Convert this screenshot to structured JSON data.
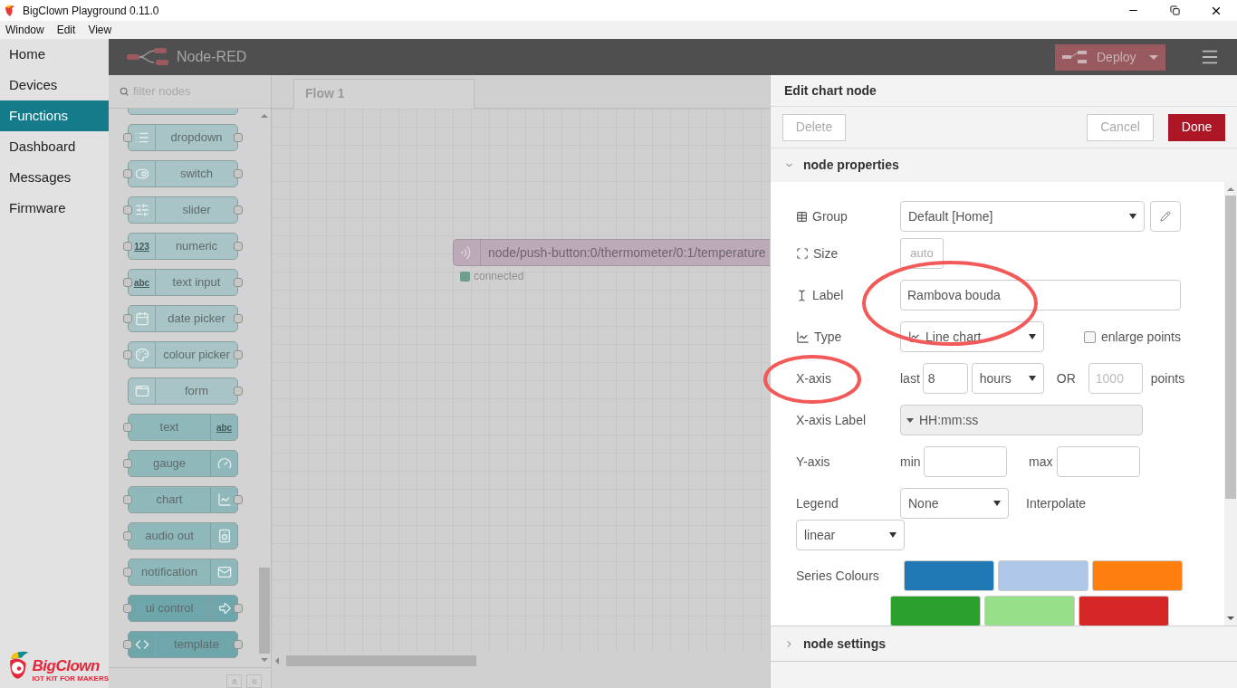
{
  "window": {
    "title": "BigClown Playground 0.11.0"
  },
  "menu": [
    "Window",
    "Edit",
    "View"
  ],
  "nav": [
    {
      "label": "Home",
      "selected": false
    },
    {
      "label": "Devices",
      "selected": false
    },
    {
      "label": "Functions",
      "selected": true
    },
    {
      "label": "Dashboard",
      "selected": false
    },
    {
      "label": "Messages",
      "selected": false
    },
    {
      "label": "Firmware",
      "selected": false
    }
  ],
  "logo": {
    "name": "BigClown",
    "tagline": "IOT KIT FOR MAKERS"
  },
  "header": {
    "title": "Node-RED",
    "deploy": "Deploy"
  },
  "palette": {
    "filter_placeholder": "filter nodes",
    "nodes": [
      {
        "label": "dropdown",
        "icon_left": true,
        "port_in": true,
        "port_out": true,
        "color": "#a9c4c6"
      },
      {
        "label": "switch",
        "icon_left": true,
        "port_in": true,
        "port_out": true,
        "color": "#a9c4c6"
      },
      {
        "label": "slider",
        "icon_left": true,
        "port_in": true,
        "port_out": true,
        "color": "#a9c4c6"
      },
      {
        "label": "numeric",
        "icon_left": true,
        "icon_text": "123",
        "port_in": true,
        "port_out": true,
        "color": "#a9c4c6"
      },
      {
        "label": "text input",
        "icon_left": true,
        "icon_text": "abc",
        "port_in": true,
        "port_out": true,
        "color": "#a9c4c6"
      },
      {
        "label": "date picker",
        "icon_left": true,
        "port_in": true,
        "port_out": true,
        "color": "#a9c4c6"
      },
      {
        "label": "colour picker",
        "icon_left": true,
        "port_in": true,
        "port_out": true,
        "color": "#a9c4c6"
      },
      {
        "label": "form",
        "icon_left": true,
        "port_in": false,
        "port_out": true,
        "color": "#a9c4c6"
      },
      {
        "label": "text",
        "icon_left": false,
        "icon_text": "abc",
        "port_in": true,
        "port_out": false,
        "color": "#8fb8bb"
      },
      {
        "label": "gauge",
        "icon_left": false,
        "port_in": true,
        "port_out": false,
        "color": "#8fb8bb"
      },
      {
        "label": "chart",
        "icon_left": false,
        "port_in": true,
        "port_out": true,
        "color": "#8fb8bb"
      },
      {
        "label": "audio out",
        "icon_left": false,
        "port_in": true,
        "port_out": false,
        "color": "#8fb8bb"
      },
      {
        "label": "notification",
        "icon_left": false,
        "port_in": true,
        "port_out": false,
        "color": "#8fb8bb"
      },
      {
        "label": "ui control",
        "icon_left": false,
        "port_in": true,
        "port_out": true,
        "color": "#6ea6ab"
      },
      {
        "label": "template",
        "icon_left": true,
        "port_in": true,
        "port_out": true,
        "color": "#6ea6ab"
      }
    ]
  },
  "workspace": {
    "tabs": [
      {
        "label": "Flow 1",
        "selected": true
      }
    ],
    "nodes": [
      {
        "label": "node/push-button:0/thermometer/0:1/temperature",
        "status": "connected",
        "color": "#6f9f8c"
      }
    ]
  },
  "editor": {
    "title": "Edit chart node",
    "delete": "Delete",
    "cancel": "Cancel",
    "done": "Done",
    "sections": [
      {
        "title": "node properties",
        "expanded": true
      },
      {
        "title": "node settings",
        "expanded": false
      }
    ],
    "form": {
      "group": {
        "label": "Group",
        "value": "Default [Home]"
      },
      "size": {
        "label": "Size",
        "value": "auto"
      },
      "label": {
        "label": "Label",
        "value": "Rambova bouda",
        "circled": true
      },
      "type": {
        "label": "Type",
        "value": "Line chart",
        "enlarge_label": "enlarge points",
        "enlarge_checked": false
      },
      "x_axis": {
        "label": "X-axis",
        "circled": true,
        "last": "last",
        "last_value": "8",
        "unit": "hours",
        "or": "OR",
        "points_placeholder": "1000",
        "points": "points"
      },
      "x_axis_label": {
        "label": "X-axis Label",
        "value": "HH:mm:ss"
      },
      "y_axis": {
        "label": "Y-axis",
        "min": "min",
        "max": "max"
      },
      "legend": {
        "label": "Legend",
        "value": "None",
        "interpolate_label": "Interpolate",
        "interpolate_value": "linear"
      },
      "series_colours": {
        "label": "Series Colours",
        "colors": [
          {
            "color": "#1f77b4"
          },
          {
            "color": "#aec7e8"
          },
          {
            "color": "#ff7f0e"
          },
          {
            "color": "#2ca02c"
          },
          {
            "color": "#98df8a"
          },
          {
            "color": "#d62728"
          }
        ]
      }
    }
  }
}
